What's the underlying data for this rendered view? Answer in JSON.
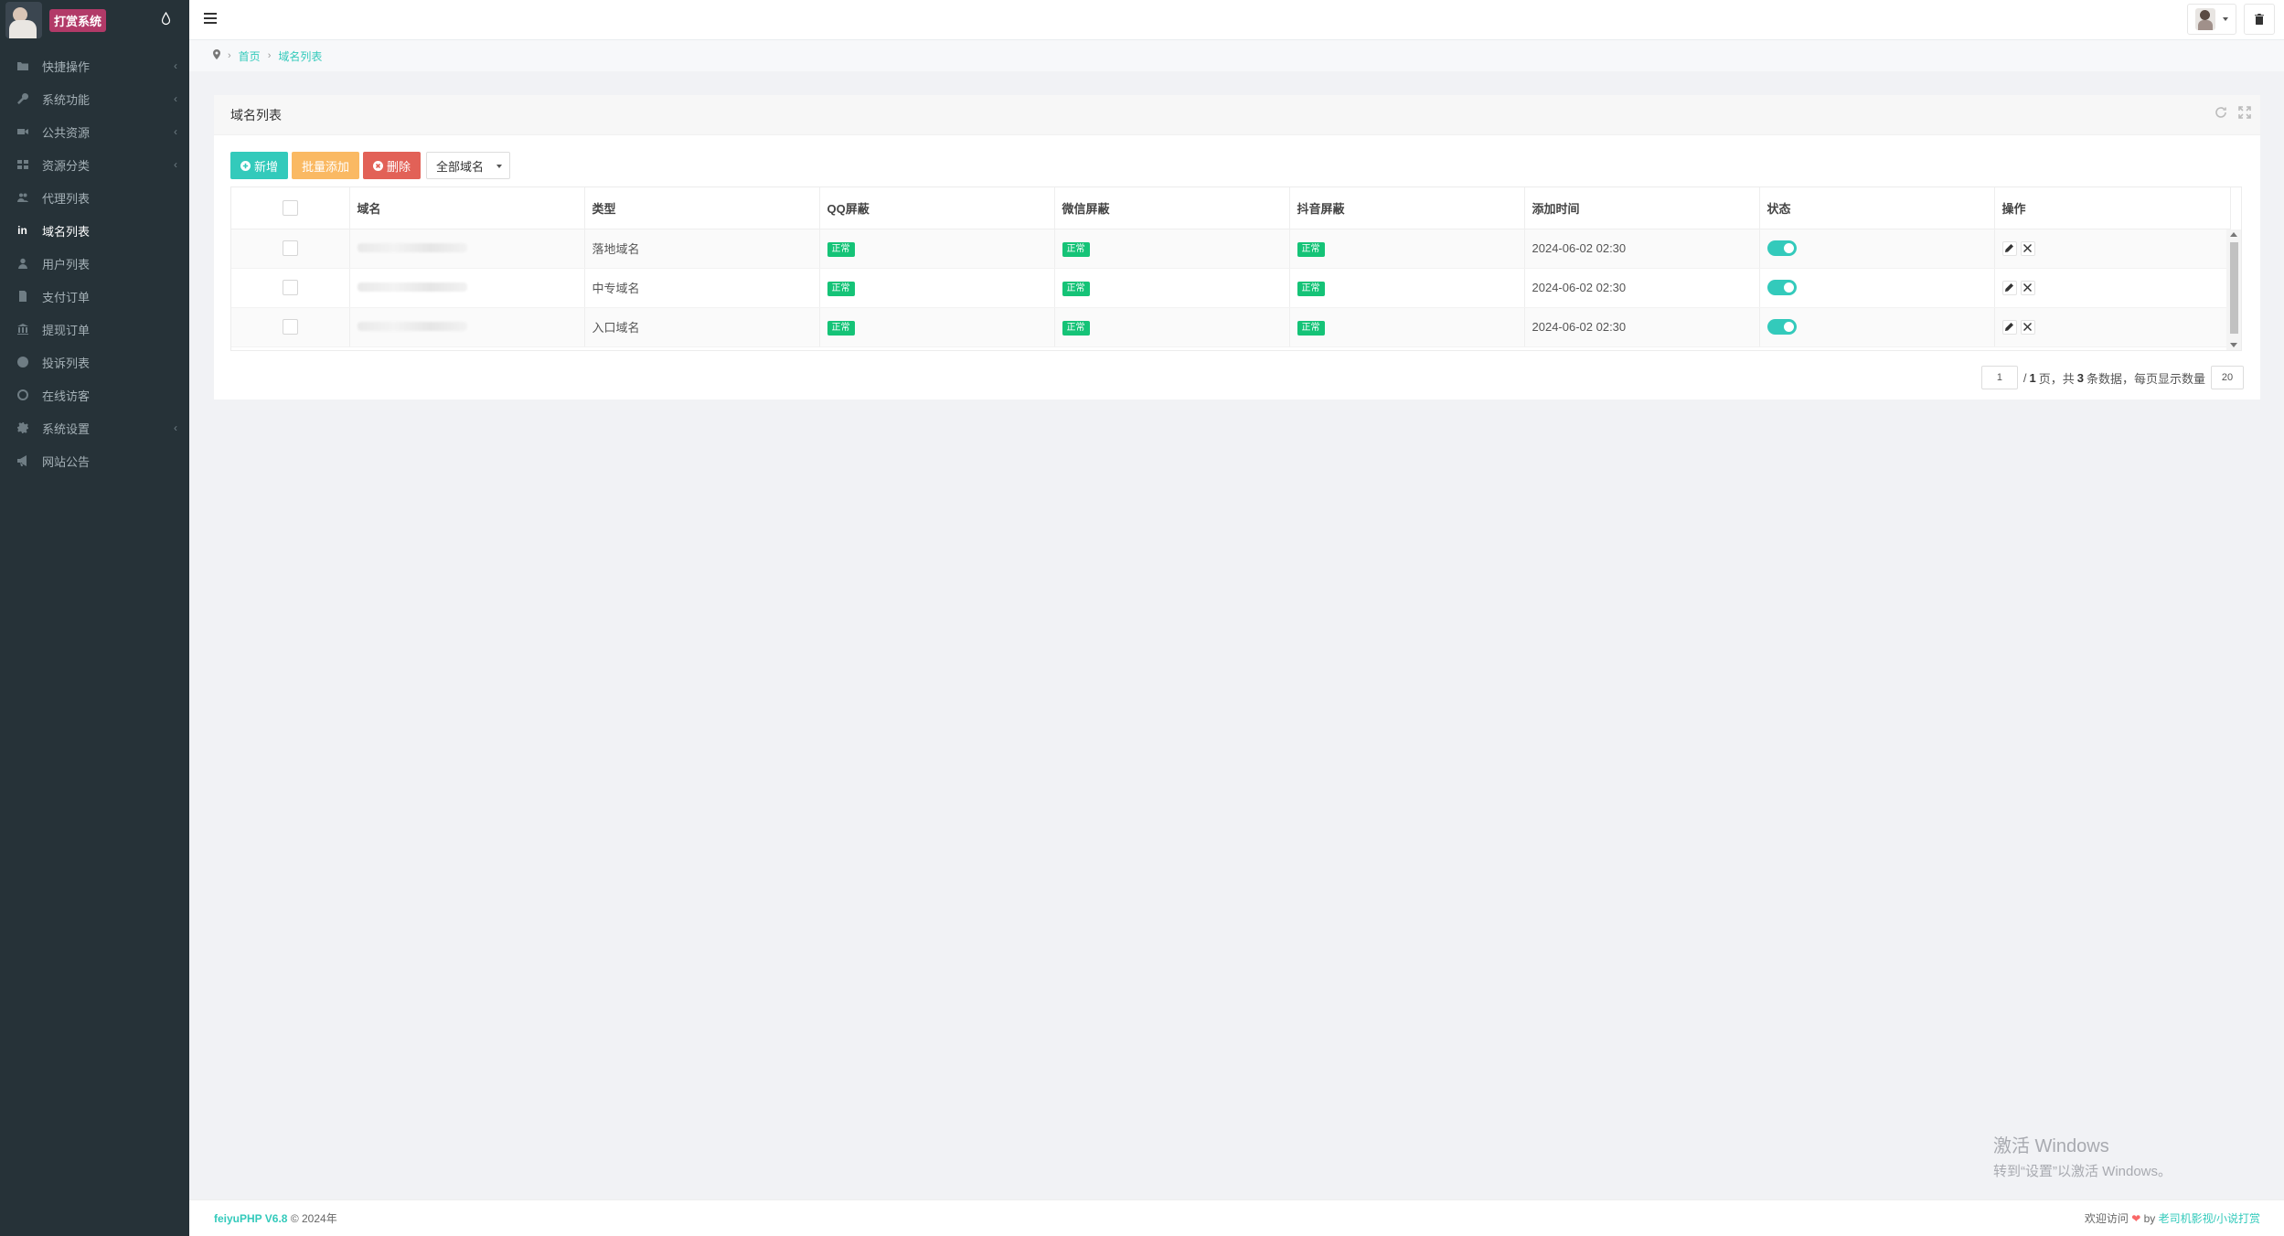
{
  "sidebar": {
    "brand_title": "打赏系统",
    "items": [
      {
        "label": "快捷操作",
        "icon": "folder-icon",
        "has_arrow": true
      },
      {
        "label": "系统功能",
        "icon": "wrench-icon",
        "has_arrow": true
      },
      {
        "label": "公共资源",
        "icon": "camera-icon",
        "has_arrow": true
      },
      {
        "label": "资源分类",
        "icon": "grid-icon",
        "has_arrow": true
      },
      {
        "label": "代理列表",
        "icon": "users-icon",
        "has_arrow": false
      },
      {
        "label": "域名列表",
        "icon": "linkedin-icon",
        "has_arrow": false,
        "active": true
      },
      {
        "label": "用户列表",
        "icon": "user-icon",
        "has_arrow": false
      },
      {
        "label": "支付订单",
        "icon": "file-icon",
        "has_arrow": false
      },
      {
        "label": "提现订单",
        "icon": "bank-icon",
        "has_arrow": false
      },
      {
        "label": "投诉列表",
        "icon": "alert-icon",
        "has_arrow": false
      },
      {
        "label": "在线访客",
        "icon": "globe-icon",
        "has_arrow": false
      },
      {
        "label": "系统设置",
        "icon": "gear-icon",
        "has_arrow": true
      },
      {
        "label": "网站公告",
        "icon": "megaphone-icon",
        "has_arrow": false
      }
    ],
    "arrow_glyph": "‹"
  },
  "breadcrumb": {
    "separator": "›",
    "home": "首页",
    "current": "域名列表"
  },
  "card": {
    "title": "域名列表"
  },
  "toolbar": {
    "add_label": "新增",
    "batch_label": "批量添加",
    "delete_label": "删除",
    "filter_value": "全部域名"
  },
  "table": {
    "headers": [
      "域名",
      "类型",
      "QQ屏蔽",
      "微信屏蔽",
      "抖音屏蔽",
      "添加时间",
      "状态",
      "操作"
    ],
    "rows": [
      {
        "type": "落地域名",
        "qq": "正常",
        "wechat": "正常",
        "douyin": "正常",
        "time": "2024-06-02 02:30",
        "status": true
      },
      {
        "type": "中专域名",
        "qq": "正常",
        "wechat": "正常",
        "douyin": "正常",
        "time": "2024-06-02 02:30",
        "status": true
      },
      {
        "type": "入口域名",
        "qq": "正常",
        "wechat": "正常",
        "douyin": "正常",
        "time": "2024-06-02 02:30",
        "status": true
      }
    ]
  },
  "pager": {
    "page_input": "1",
    "slash": "/",
    "total_pages": "1",
    "page_suffix": "页，共",
    "total_rows": "3",
    "rows_suffix": "条数据，每页显示数量",
    "page_size": "20"
  },
  "watermark": {
    "line1": "激活 Windows",
    "line2": "转到“设置”以激活 Windows。"
  },
  "footer": {
    "brand": "feiyuPHP V6.8",
    "copyright": "© 2024年",
    "welcome": "欢迎访问",
    "heart": "❤",
    "by": "by",
    "author": "老司机影视/小说打赏"
  },
  "colors": {
    "sidebar_bg": "#263238",
    "accent": "#33cabb",
    "success": "#15c377",
    "warning": "#fab963",
    "danger": "#e26157",
    "brand_badge": "#b23a68"
  }
}
